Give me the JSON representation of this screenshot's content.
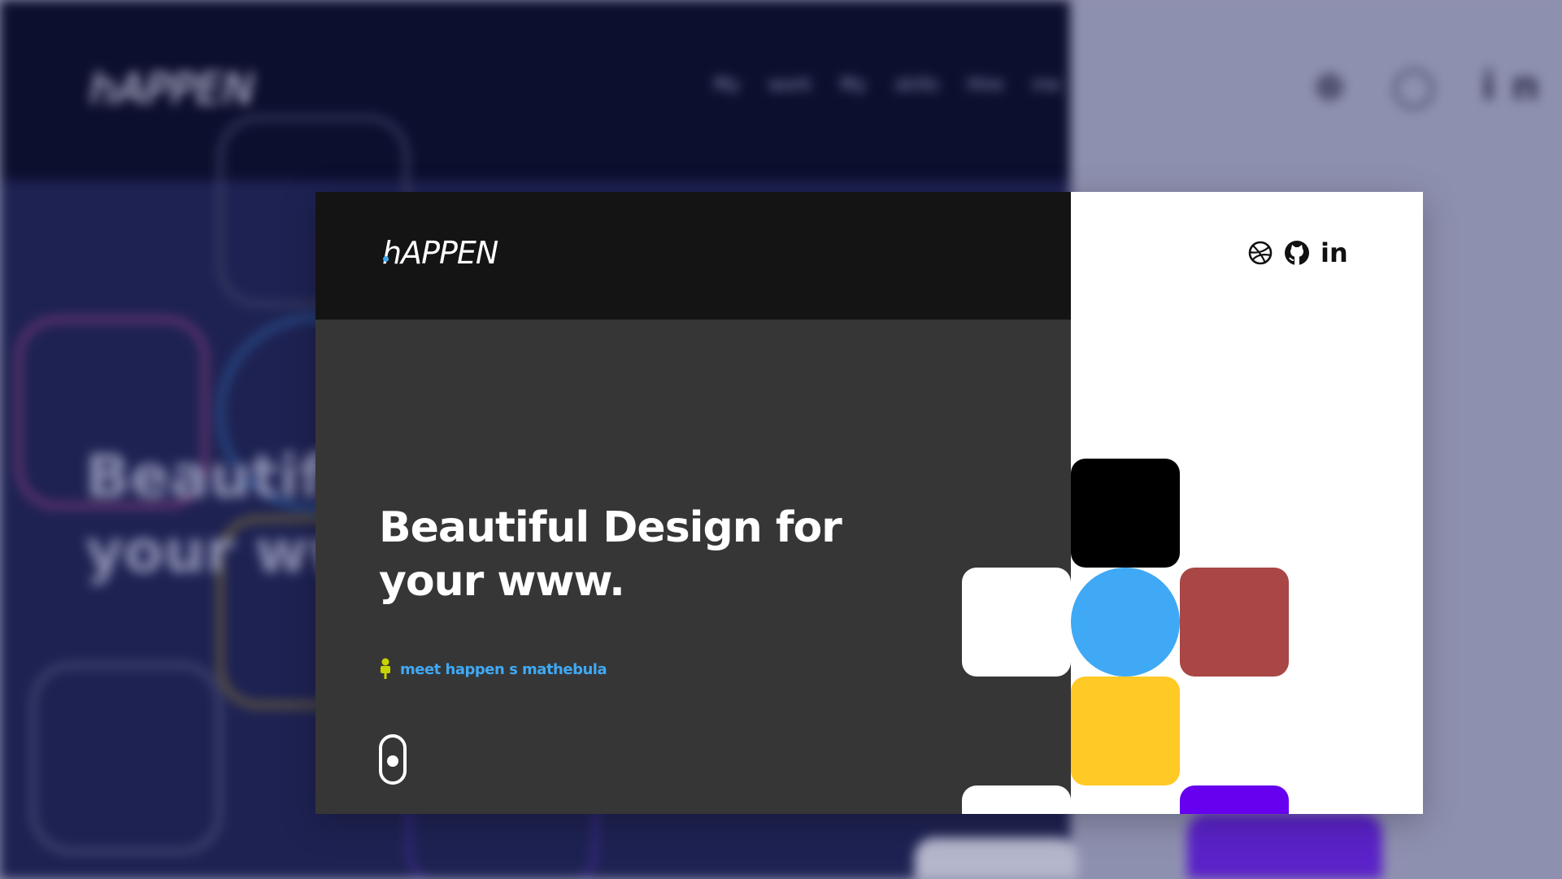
{
  "brand": {
    "logo_text": "hAPPEN"
  },
  "nav": {
    "items": [
      {
        "label": "My work"
      },
      {
        "label": "My skills"
      },
      {
        "label": "Hire me"
      }
    ]
  },
  "social": {
    "icons": [
      "dribbble-icon",
      "github-icon",
      "linkedin-icon"
    ],
    "linkedin_text": "in"
  },
  "hero": {
    "title_line1": "Beautiful Design for",
    "title_line2": "your www.",
    "meet_label": "meet happen s mathebula"
  },
  "background_blurred": {
    "logo_text": "hAPPEN",
    "nav_text": "My work My skills Hire me",
    "social_text": "⊕ ◯ in",
    "title_line1": "Beautiful Design for",
    "title_line2": "your www."
  },
  "colors": {
    "page_background": "#8e90b0",
    "dark_header": "#141414",
    "dark_panel": "#363636",
    "accent_blue": "#3fa9f5",
    "accent_yellow_green": "#c8d400",
    "block_black": "#000000",
    "block_white": "#ffffff",
    "block_red": "#a94646",
    "block_yellow": "#ffc926",
    "block_purple": "#6600ee"
  }
}
